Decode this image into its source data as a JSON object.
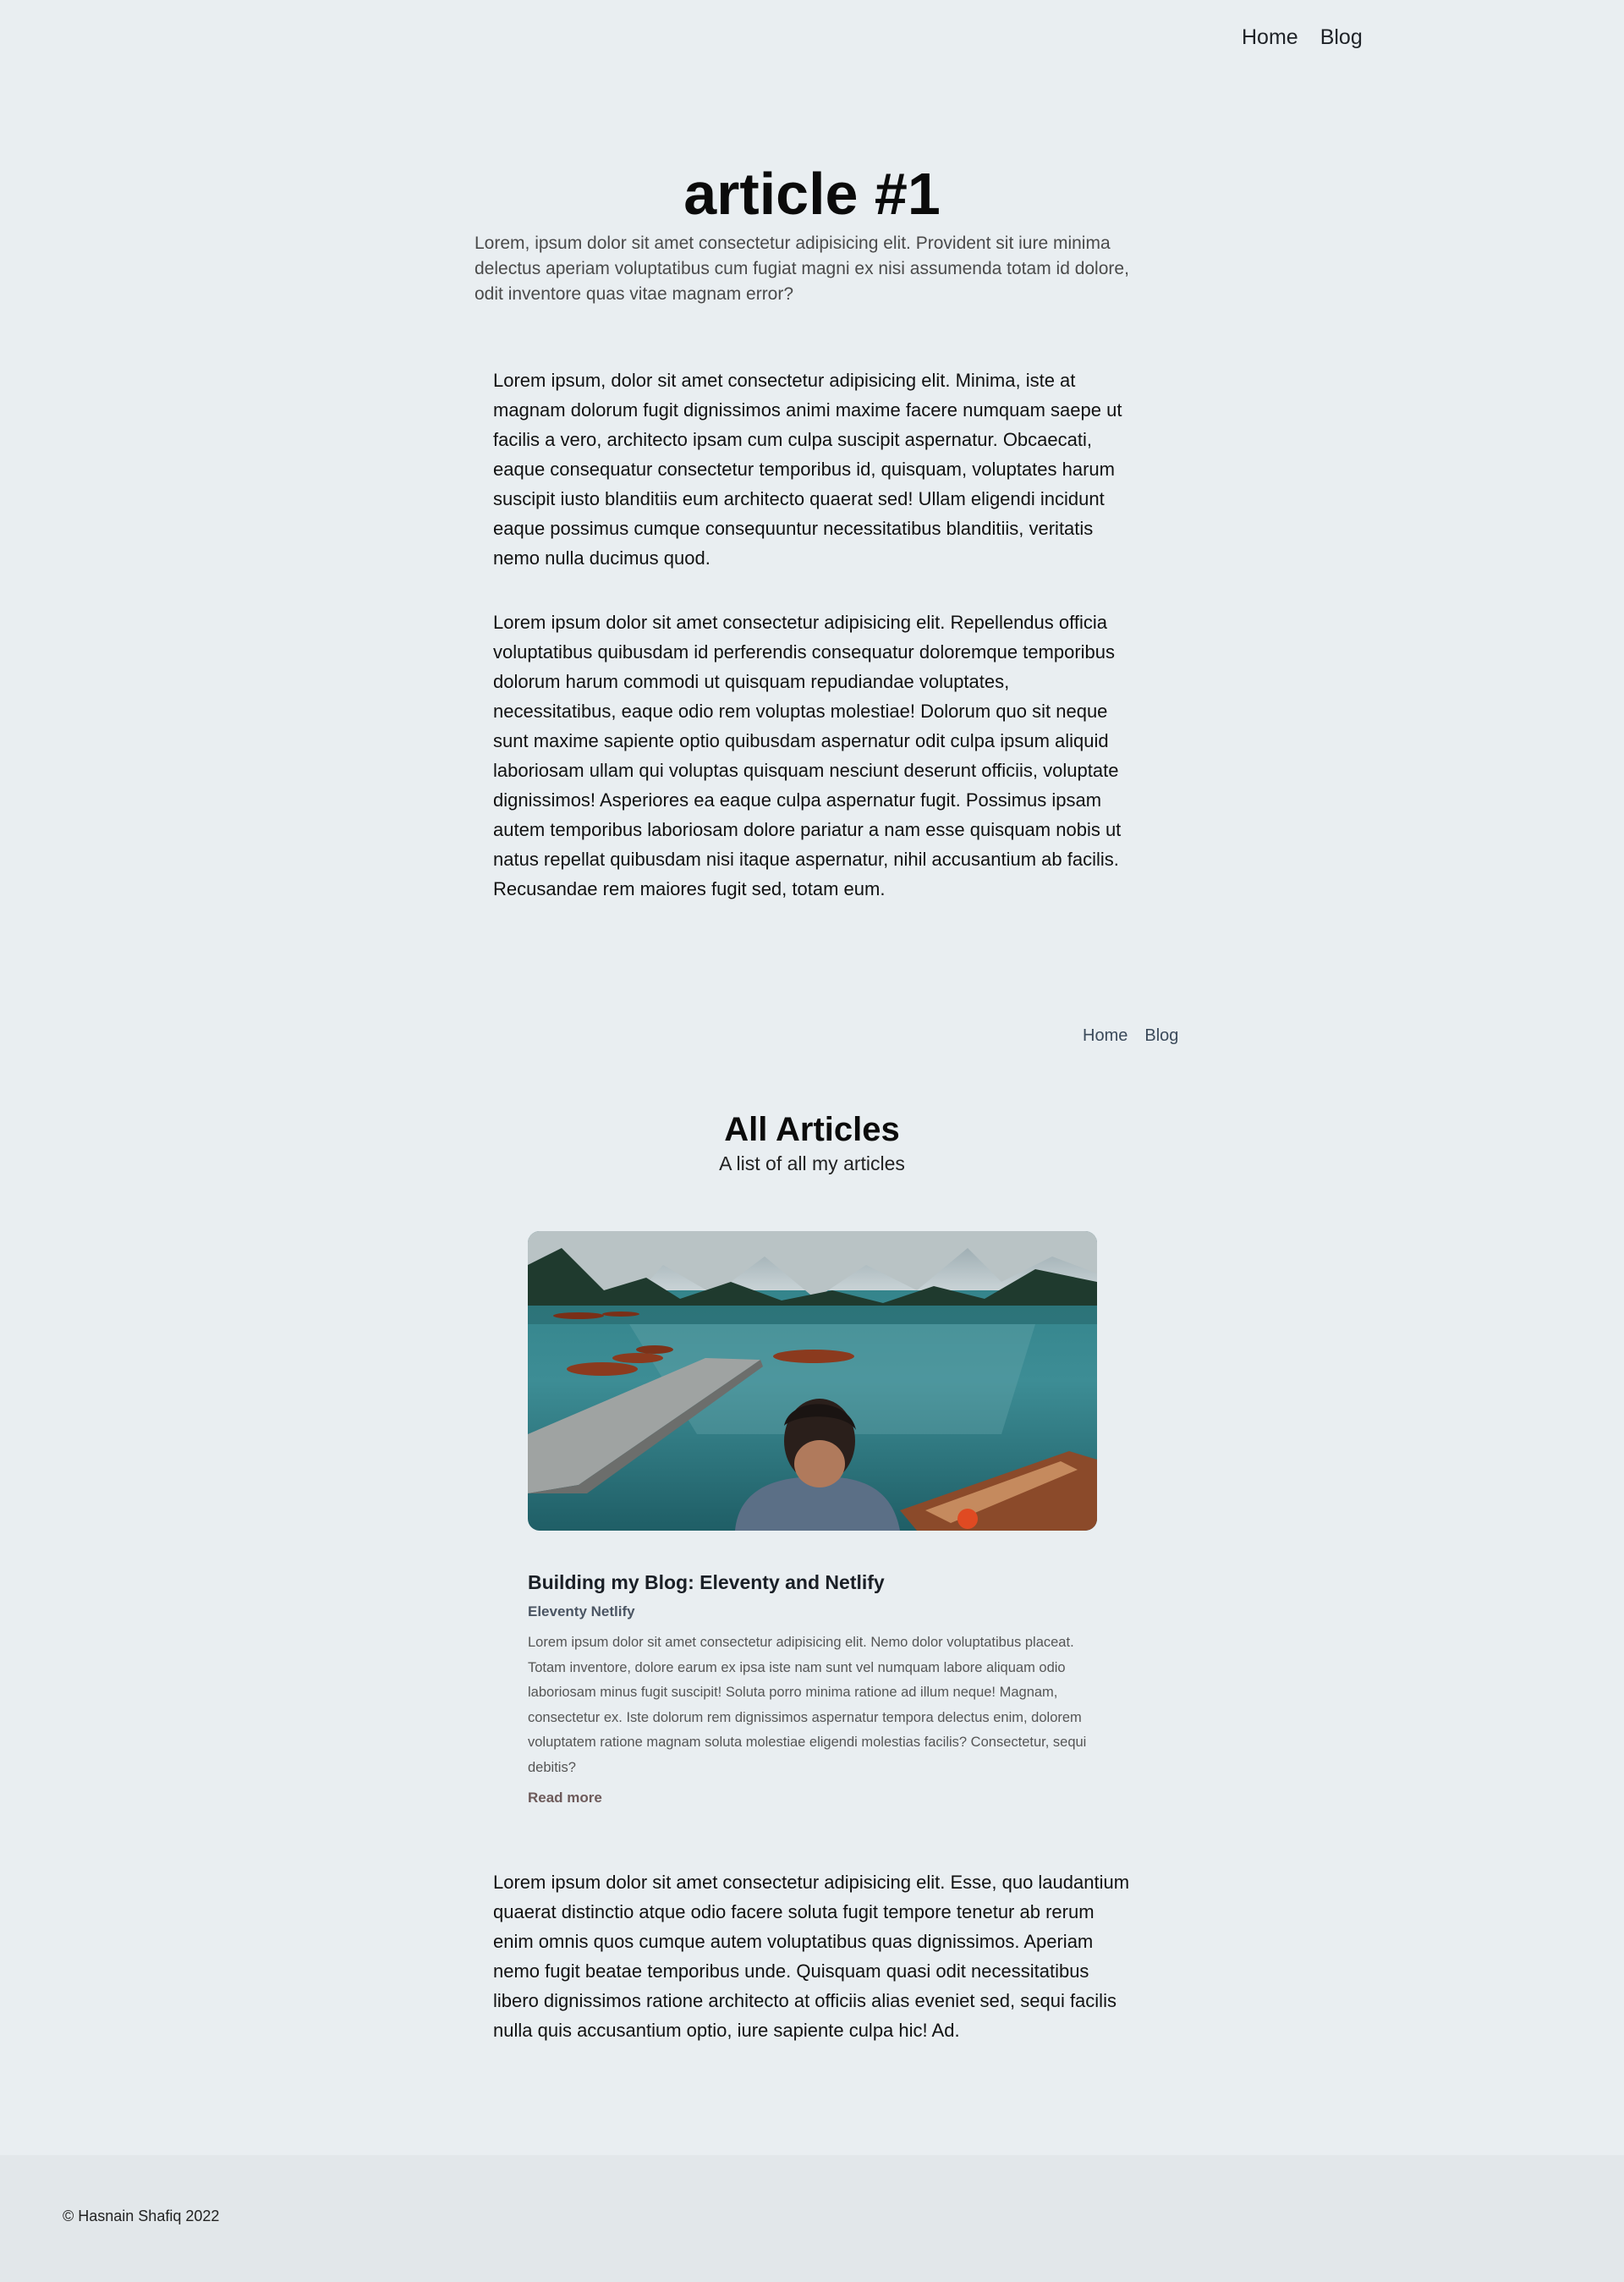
{
  "nav": {
    "home": "Home",
    "blog": "Blog"
  },
  "article": {
    "title": "article #1",
    "subtitle": "Lorem, ipsum dolor sit amet consectetur adipisicing elit. Provident sit iure minima delectus aperiam voluptatibus cum fugiat magni ex nisi assumenda totam id dolore, odit inventore quas vitae magnam error?",
    "paragraphs": [
      "Lorem ipsum, dolor sit amet consectetur adipisicing elit. Minima, iste at magnam dolorum fugit dignissimos animi maxime facere numquam saepe ut facilis a vero, architecto ipsam cum culpa suscipit aspernatur. Obcaecati, eaque consequatur consectetur temporibus id, quisquam, voluptates harum suscipit iusto blanditiis eum architecto quaerat sed! Ullam eligendi incidunt eaque possimus cumque consequuntur necessitatibus blanditiis, veritatis nemo nulla ducimus quod.",
      "Lorem ipsum dolor sit amet consectetur adipisicing elit. Repellendus officia voluptatibus quibusdam id perferendis consequatur doloremque temporibus dolorum harum commodi ut quisquam repudiandae voluptates, necessitatibus, eaque odio rem voluptas molestiae! Dolorum quo sit neque sunt maxime sapiente optio quibusdam aspernatur odit culpa ipsum aliquid laboriosam ullam qui voluptas quisquam nesciunt deserunt officiis, voluptate dignissimos! Asperiores ea eaque culpa aspernatur fugit. Possimus ipsam autem temporibus laboriosam dolore pariatur a nam esse quisquam nobis ut natus repellat quibusdam nisi itaque aspernatur, nihil accusantium ab facilis. Recusandae rem maiores fugit sed, totam eum.",
      "Lorem ipsum dolor sit amet consectetur adipisicing elit. Esse, quo laudantium quaerat distinctio atque odio facere soluta fugit tempore tenetur ab rerum enim omnis quos cumque autem voluptatibus quas dignissimos. Aperiam nemo fugit beatae temporibus unde. Quisquam quasi odit necessitatibus libero dignissimos ratione architecto at officiis alias eveniet sed, sequi facilis nulla quis accusantium optio, iure sapiente culpa hic! Ad."
    ]
  },
  "inner_nav": {
    "home": "Home",
    "blog": "Blog"
  },
  "all_articles": {
    "title": "All Articles",
    "subtitle": "A list of all my articles",
    "cards": [
      {
        "image": "lake-boats-photo",
        "title": "Building my Blog: Eleventy and Netlify",
        "tags": "Eleventy Netlify",
        "description": "Lorem ipsum dolor sit amet consectetur adipisicing elit. Nemo dolor voluptatibus placeat. Totam inventore, dolore earum ex ipsa iste nam sunt vel numquam labore aliquam odio laboriosam minus fugit suscipit! Soluta porro minima ratione ad illum neque! Magnam, consectetur ex. Iste dolorum rem dignissimos aspernatur tempora delectus enim, dolorem voluptatem ratione magnam soluta molestiae eligendi molestias facilis? Consectetur, sequi debitis?",
        "read_more": "Read more"
      }
    ]
  },
  "footer": {
    "copyright": "© Hasnain Shafiq 2022"
  }
}
